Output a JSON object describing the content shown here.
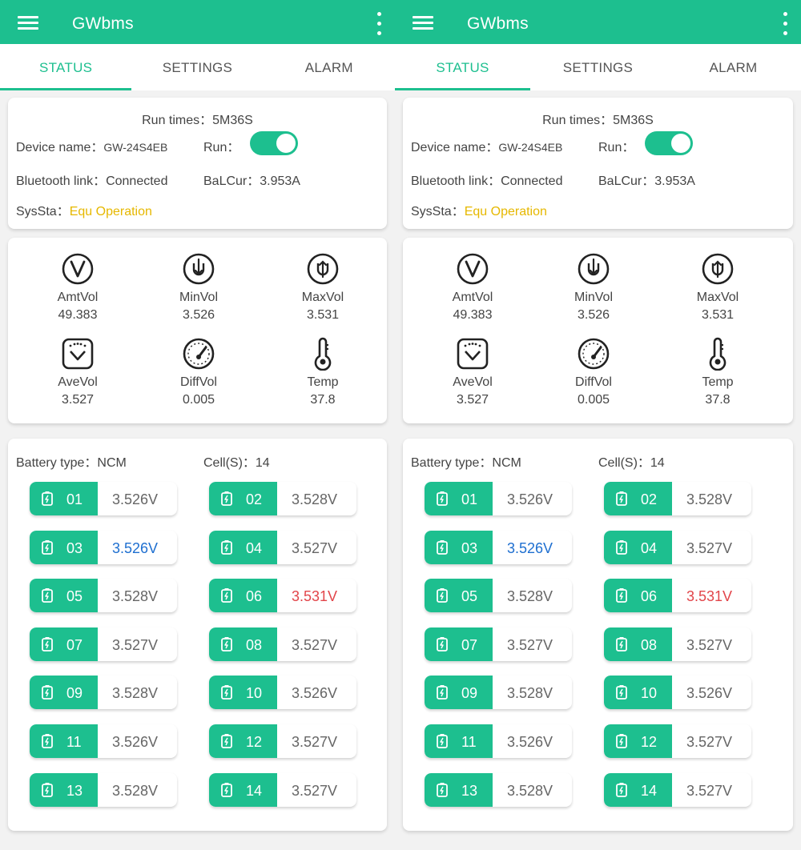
{
  "app": {
    "title": "GWbms"
  },
  "tabs": [
    "STATUS",
    "SETTINGS",
    "ALARM"
  ],
  "info": {
    "run_times_label": "Run times：",
    "run_times_value": "5M36S",
    "device_name_label": "Device name：",
    "device_name_value": "GW-24S4EB",
    "run_label": "Run：",
    "run_on": true,
    "bluetooth_label": "Bluetooth link：",
    "bluetooth_value": "Connected",
    "balcur_label": "BaLCur：",
    "balcur_value": "3.953A",
    "syssta_label": "SysSta：",
    "syssta_value": "Equ Operation"
  },
  "stats": [
    {
      "icon": "volt-v-icon",
      "label": "AmtVol",
      "value": "49.383"
    },
    {
      "icon": "min-voltage-icon",
      "label": "MinVol",
      "value": "3.526"
    },
    {
      "icon": "max-voltage-icon",
      "label": "MaxVol",
      "value": "3.531"
    },
    {
      "icon": "average-voltage-icon",
      "label": "AveVol",
      "value": "3.527"
    },
    {
      "icon": "gauge-icon",
      "label": "DiffVol",
      "value": "0.005"
    },
    {
      "icon": "thermometer-icon",
      "label": "Temp",
      "value": "37.8"
    }
  ],
  "battery": {
    "type_label": "Battery type：",
    "type_value": "NCM",
    "cells_label": "Cell(S)：",
    "cells_value": "14"
  },
  "cells": [
    {
      "num": "01",
      "volt": "3.526V",
      "state": "normal"
    },
    {
      "num": "02",
      "volt": "3.528V",
      "state": "normal"
    },
    {
      "num": "03",
      "volt": "3.526V",
      "state": "min"
    },
    {
      "num": "04",
      "volt": "3.527V",
      "state": "normal"
    },
    {
      "num": "05",
      "volt": "3.528V",
      "state": "normal"
    },
    {
      "num": "06",
      "volt": "3.531V",
      "state": "max"
    },
    {
      "num": "07",
      "volt": "3.527V",
      "state": "normal"
    },
    {
      "num": "08",
      "volt": "3.527V",
      "state": "normal"
    },
    {
      "num": "09",
      "volt": "3.528V",
      "state": "normal"
    },
    {
      "num": "10",
      "volt": "3.526V",
      "state": "normal"
    },
    {
      "num": "11",
      "volt": "3.526V",
      "state": "normal"
    },
    {
      "num": "12",
      "volt": "3.527V",
      "state": "normal"
    },
    {
      "num": "13",
      "volt": "3.528V",
      "state": "normal"
    },
    {
      "num": "14",
      "volt": "3.527V",
      "state": "normal"
    }
  ],
  "colors": {
    "accent": "#1dbf8f",
    "warning": "#e6b800",
    "min": "#1e6fd0",
    "max": "#e2454a"
  }
}
